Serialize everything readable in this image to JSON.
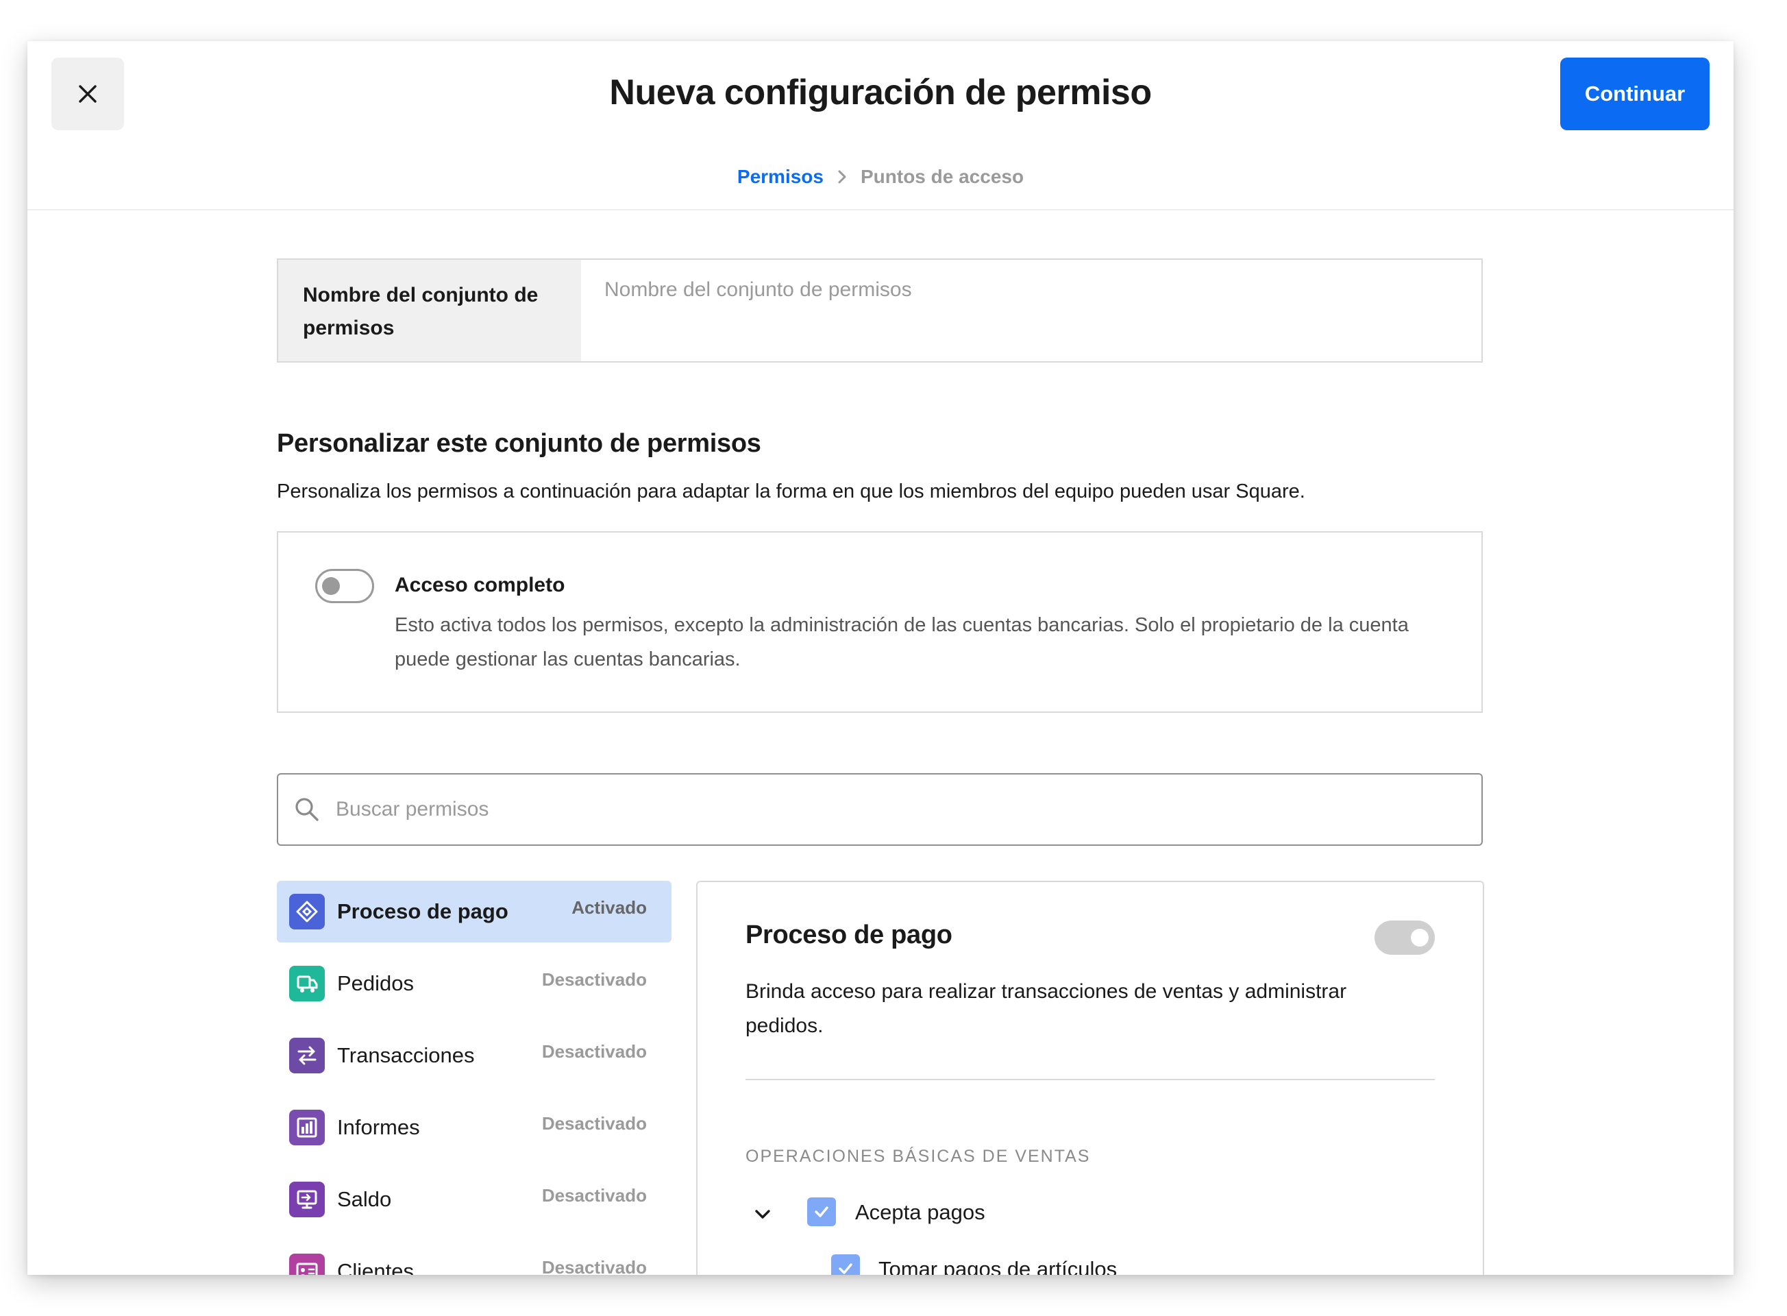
{
  "header": {
    "close_icon": "close-icon",
    "title": "Nueva configuración de permiso",
    "continue_label": "Continuar",
    "accent_color": "#0b6cf3"
  },
  "breadcrumb": {
    "step1": "Permisos",
    "step2": "Puntos de acceso"
  },
  "name_field": {
    "label": "Nombre del conjunto de permisos",
    "placeholder": "Nombre del conjunto de permisos",
    "value": ""
  },
  "customize": {
    "title": "Personalizar este conjunto de permisos",
    "description": "Personaliza los permisos a continuación para adaptar la forma en que los miembros del equipo pueden usar Square."
  },
  "full_access": {
    "title": "Acceso completo",
    "description": "Esto activa todos los permisos, excepto la administración de las cuentas bancarias. Solo el propietario de la cuenta puede gestionar las cuentas bancarias.",
    "enabled": false
  },
  "search": {
    "placeholder": "Buscar permisos"
  },
  "categories": [
    {
      "name": "Proceso de pago",
      "status": "Activado",
      "icon": "checkout-icon",
      "color": "#4a63d8"
    },
    {
      "name": "Pedidos",
      "status": "Desactivado",
      "icon": "orders-icon",
      "color": "#1fb99a"
    },
    {
      "name": "Transacciones",
      "status": "Desactivado",
      "icon": "transactions-icon",
      "color": "#6d4aa6"
    },
    {
      "name": "Informes",
      "status": "Desactivado",
      "icon": "reports-icon",
      "color": "#7a4cb0"
    },
    {
      "name": "Saldo",
      "status": "Desactivado",
      "icon": "balance-icon",
      "color": "#7a3fae"
    },
    {
      "name": "Clientes",
      "status": "Desactivado",
      "icon": "customers-icon",
      "color": "#b03fa0"
    }
  ],
  "detail": {
    "title": "Proceso de pago",
    "description": "Brinda acceso para realizar transacciones de ventas y administrar pedidos.",
    "enabled": true,
    "group_title": "OPERACIONES BÁSICAS DE VENTAS",
    "items": [
      {
        "label": "Acepta pagos",
        "checked": true
      },
      {
        "label": "Tomar pagos de artículos",
        "checked": true
      }
    ]
  }
}
